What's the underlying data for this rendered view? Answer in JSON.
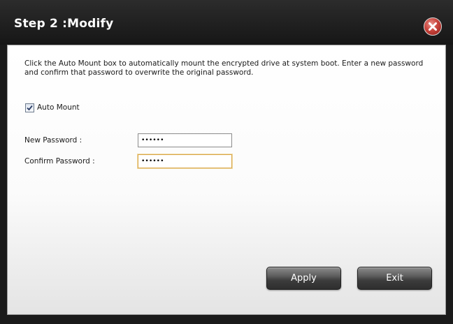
{
  "dialog": {
    "title": "Step 2 :Modify",
    "close_icon": "close-x-icon",
    "accent_close": "#c8443c"
  },
  "content": {
    "description": "Click the Auto Mount box to automatically mount the encrypted drive at system boot. Enter a new password and confirm that password to overwrite the original password.",
    "auto_mount": {
      "label": "Auto Mount",
      "checked": true
    },
    "fields": {
      "new_password": {
        "label": "New Password :",
        "value": "••••••"
      },
      "confirm_password": {
        "label": "Confirm Password :",
        "value": "••••••"
      }
    }
  },
  "buttons": {
    "apply": "Apply",
    "exit": "Exit"
  }
}
